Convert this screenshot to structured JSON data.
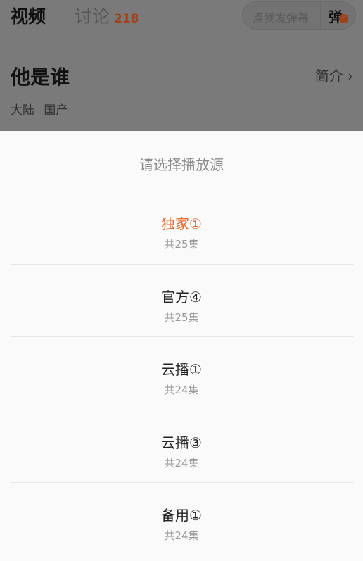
{
  "tabs": {
    "video_label": "视频",
    "discuss_label": "讨论",
    "discuss_count": "218"
  },
  "danmaku": {
    "placeholder": "点我发弹幕",
    "button_label": "弹",
    "badge": "✓"
  },
  "show": {
    "title": "他是谁",
    "intro_label": "简介 ›",
    "tags": [
      "大陆",
      "国产"
    ]
  },
  "sheet": {
    "title": "请选择播放源",
    "sources": [
      {
        "name": "独家①",
        "count": "共25集",
        "active": true
      },
      {
        "name": "官方④",
        "count": "共25集",
        "active": false
      },
      {
        "name": "云播①",
        "count": "共24集",
        "active": false
      },
      {
        "name": "云播③",
        "count": "共24集",
        "active": false
      },
      {
        "name": "备用①",
        "count": "共24集",
        "active": false
      }
    ]
  },
  "colors": {
    "accent": "#ea6a2c",
    "overlay": "#7a7a7a"
  }
}
